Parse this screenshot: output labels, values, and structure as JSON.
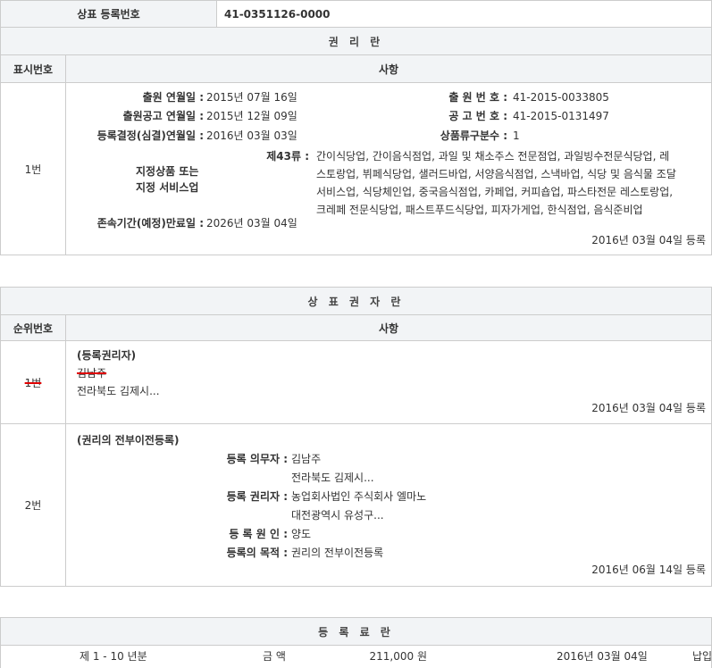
{
  "header": {
    "reg_no_label": "상표 등록번호",
    "reg_no_value": "41-0351126-0000"
  },
  "rights": {
    "title": "권 리 란",
    "col_no": "표시번호",
    "col_item": "사항",
    "row_no": "1번",
    "app_date_label": "출원 연월일 :",
    "app_date_value": "2015년 07월 16일",
    "app_no_label": "출 원 번 호 :",
    "app_no_value": "41-2015-0033805",
    "pub_date_label": "출원공고 연월일 :",
    "pub_date_value": "2015년 12월 09일",
    "pub_no_label": "공 고 번 호 :",
    "pub_no_value": "41-2015-0131497",
    "decision_label": "등록결정(심결)연월일 :",
    "decision_value": "2016년 03월 03일",
    "class_count_label": "상품류구분수 :",
    "class_count_value": "1",
    "goods_label_1": "지정상품 또는",
    "goods_label_2": "지정 서비스업",
    "class_label": "제43류 :",
    "goods_line1": "간이식당업, 간이음식점업, 과일 및 채소주스 전문점업, 과일빙수전문식당업, 레",
    "goods_line2": "스토랑업, 뷔페식당업, 샐러드바업, 서양음식점업, 스낵바업, 식당 및 음식물 조달",
    "goods_line3": "서비스업, 식당체인업, 중국음식점업, 카페업, 커피숍업, 파스타전문 레스토랑업,",
    "goods_line4": "크레페 전문식당업, 패스트푸드식당업, 피자가게업, 한식점업, 음식준비업",
    "expiry_label": "존속기간(예정)만료일 :",
    "expiry_value": "2026년 03월 04일",
    "reg_stamp": "2016년 03월 04일 등록"
  },
  "holders": {
    "title": "상 표 권 자 란",
    "col_no": "순위번호",
    "col_item": "사항",
    "row1": {
      "no": "1번",
      "heading": "(등록권리자)",
      "name": "김남주",
      "addr": "전라북도 김제시...",
      "stamp": "2016년 03월 04일 등록"
    },
    "row2": {
      "no": "2번",
      "heading": "(권리의 전부이전등록)",
      "obligor_label": "등록 의무자 :",
      "obligor_name": "김남주",
      "obligor_addr": "전라북도 김제시...",
      "holder_label": "등록 권리자 :",
      "holder_name": "농업회사법인 주식회사 엘마노",
      "holder_addr": "대전광역시 유성구...",
      "cause_label": "등 록 원 인 :",
      "cause_value": "양도",
      "purpose_label": "등록의 목적 :",
      "purpose_value": "권리의 전부이전등록",
      "stamp": "2016년 06월 14일 등록"
    }
  },
  "fees": {
    "title": "등 록 료 란",
    "period": "제 1 - 10 년분",
    "amount_label": "금 액",
    "amount_value": "211,000 원",
    "paid_date": "2016년 03월 04일",
    "status": "납입"
  }
}
